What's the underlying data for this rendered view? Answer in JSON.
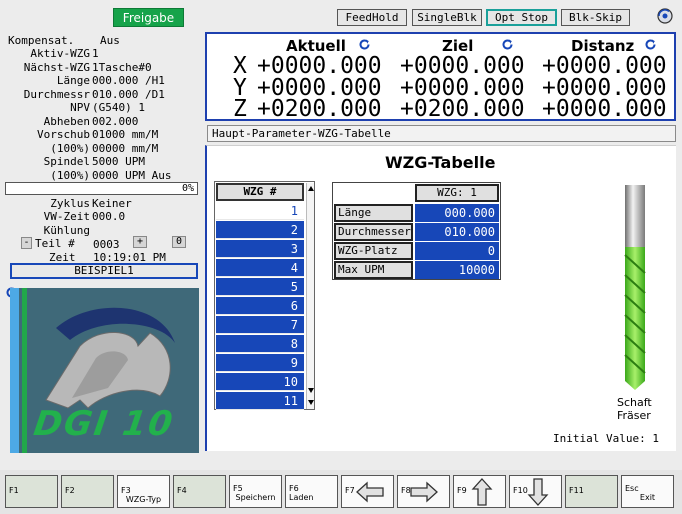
{
  "top_bar": {
    "status_badge": "Freigabe",
    "buttons": [
      "FeedHold",
      "SingleBlk",
      "Opt Stop",
      "Blk-Skip"
    ],
    "accent_color": "#1aa09a"
  },
  "left_panel": {
    "rows_a": [
      {
        "label": "Kompensat.",
        "value": "Aus"
      },
      {
        "label": "Aktiv-WZG",
        "value": "1"
      },
      {
        "label": "Nächst-WZG",
        "value": "1Tasche#0"
      },
      {
        "label": "Länge",
        "value": "000.000 /H1"
      },
      {
        "label": "Durchmessr",
        "value": "010.000 /D1"
      },
      {
        "label": "NPV",
        "value": "(G540) 1"
      },
      {
        "label": "Abheben",
        "value": "002.000"
      },
      {
        "label": "Vorschub",
        "value": "01000 mm/M"
      },
      {
        "label": "(100%)",
        "value": "00000 mm/M"
      },
      {
        "label": "Spindel",
        "value": "5000 UPM"
      },
      {
        "label": "(100%)",
        "value": "0000 UPM Aus"
      }
    ],
    "progress_text": "0%",
    "rows_b": [
      {
        "label": "Zyklus",
        "value": "Keiner"
      },
      {
        "label": "VW-Zeit",
        "value": "000.0"
      },
      {
        "label": "Kühlung",
        "value": ""
      }
    ],
    "teil_minus": "-",
    "teil_label": "Teil #",
    "teil_value": "0003",
    "teil_plus": "+",
    "teil_zero": "0",
    "zeit_label": "Zeit",
    "zeit_value": "10:19:01 PM",
    "program_name": "BEISPIEL1",
    "logo_text": "DGI 10"
  },
  "coordinates": {
    "headers": [
      "Aktuell",
      "Ziel",
      "Distanz"
    ],
    "axes": [
      {
        "axis": "X",
        "aktuell": "+0000.000",
        "ziel": "+0000.000",
        "distanz": "+0000.000"
      },
      {
        "axis": "Y",
        "aktuell": "+0000.000",
        "ziel": "+0000.000",
        "distanz": "+0000.000"
      },
      {
        "axis": "Z",
        "aktuell": "+0200.000",
        "ziel": "+0200.000",
        "distanz": "+0000.000"
      }
    ]
  },
  "title_bar": "Haupt-Parameter-WZG-Tabelle",
  "main": {
    "heading": "WZG-Tabelle",
    "list_header": "WZG #",
    "tools": [
      "1",
      "2",
      "3",
      "4",
      "5",
      "6",
      "7",
      "8",
      "9",
      "10",
      "11"
    ],
    "param_header": "WZG: 1",
    "params": [
      {
        "label": "Länge",
        "value": "000.000"
      },
      {
        "label": "Durchmesser",
        "value": "010.000"
      },
      {
        "label": "WZG-Platz",
        "value": "0"
      },
      {
        "label": "Max UPM",
        "value": "10000"
      }
    ],
    "tool_caption_1": "Schaft",
    "tool_caption_2": "Fräser",
    "initial_value": "Initial Value: 1"
  },
  "fkeys": [
    {
      "num": "F1",
      "label": ""
    },
    {
      "num": "F2",
      "label": ""
    },
    {
      "num": "F3",
      "label": "WZG-Typ"
    },
    {
      "num": "F4",
      "label": ""
    },
    {
      "num": "F5",
      "label": "Speichern"
    },
    {
      "num": "F6",
      "label": "Laden"
    },
    {
      "num": "F7",
      "label": "",
      "icon": "arrow-left-icon"
    },
    {
      "num": "F8",
      "label": "",
      "icon": "arrow-right-icon"
    },
    {
      "num": "F9",
      "label": "",
      "icon": "arrow-up-icon"
    },
    {
      "num": "F10",
      "label": "",
      "icon": "arrow-down-icon"
    },
    {
      "num": "F11",
      "label": ""
    },
    {
      "num": "Esc",
      "label": "Exit"
    }
  ]
}
